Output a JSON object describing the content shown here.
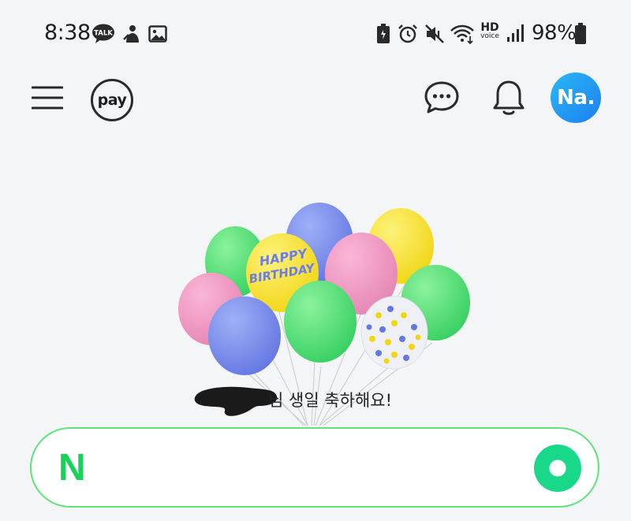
{
  "status_bar": {
    "time": "8:38",
    "left_icons": [
      "kakaotalk-icon",
      "person-icon",
      "gallery-icon"
    ],
    "talk_badge": "TALK",
    "right_icons": [
      "battery-saver-icon",
      "alarm-icon",
      "mute-icon",
      "wifi-icon",
      "hd-voice-icon",
      "signal-icon",
      "battery-icon"
    ],
    "hd_label": "HD",
    "voice_label": "voice",
    "battery_percent": "98%"
  },
  "header": {
    "menu_icon": "hamburger-menu-icon",
    "pay_label": "pay",
    "chat_icon": "chat-bubble-icon",
    "notification_icon": "bell-icon",
    "avatar_label": "Na."
  },
  "main": {
    "balloon_text_line1": "HAPPY",
    "balloon_text_line2": "BIRTHDAY",
    "greeting_suffix": "님 생일 축하해요!"
  },
  "search": {
    "logo": "N",
    "placeholder": "",
    "action_icon": "green-dot-icon"
  },
  "colors": {
    "background": "#f4f5f7",
    "search_border": "#5ee37a",
    "naver_green": "#19d25a",
    "avatar_blue": "#1e7ff0"
  }
}
